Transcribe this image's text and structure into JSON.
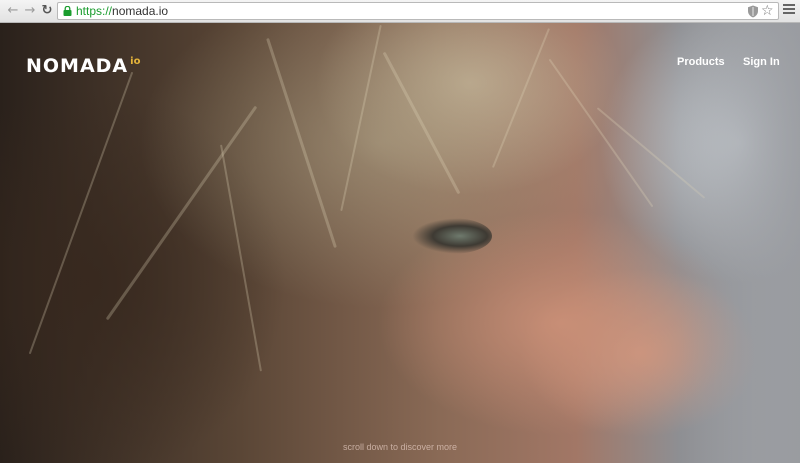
{
  "browser": {
    "back_icon": "back-arrow-icon",
    "forward_icon": "forward-arrow-icon",
    "reload_icon": "reload-icon",
    "url_scheme": "https://",
    "url_host": "nomada.io",
    "bookmark_icon": "star-icon",
    "menu_icon": "hamburger-menu-icon",
    "secure_color": "#1a9d2e"
  },
  "site": {
    "logo_text": "NOMADA",
    "logo_suffix": "io",
    "logo_accent_color": "#e5b43a",
    "nav": {
      "products": "Products",
      "sign_in": "Sign In"
    },
    "scroll_hint": "scroll down to discover more"
  }
}
